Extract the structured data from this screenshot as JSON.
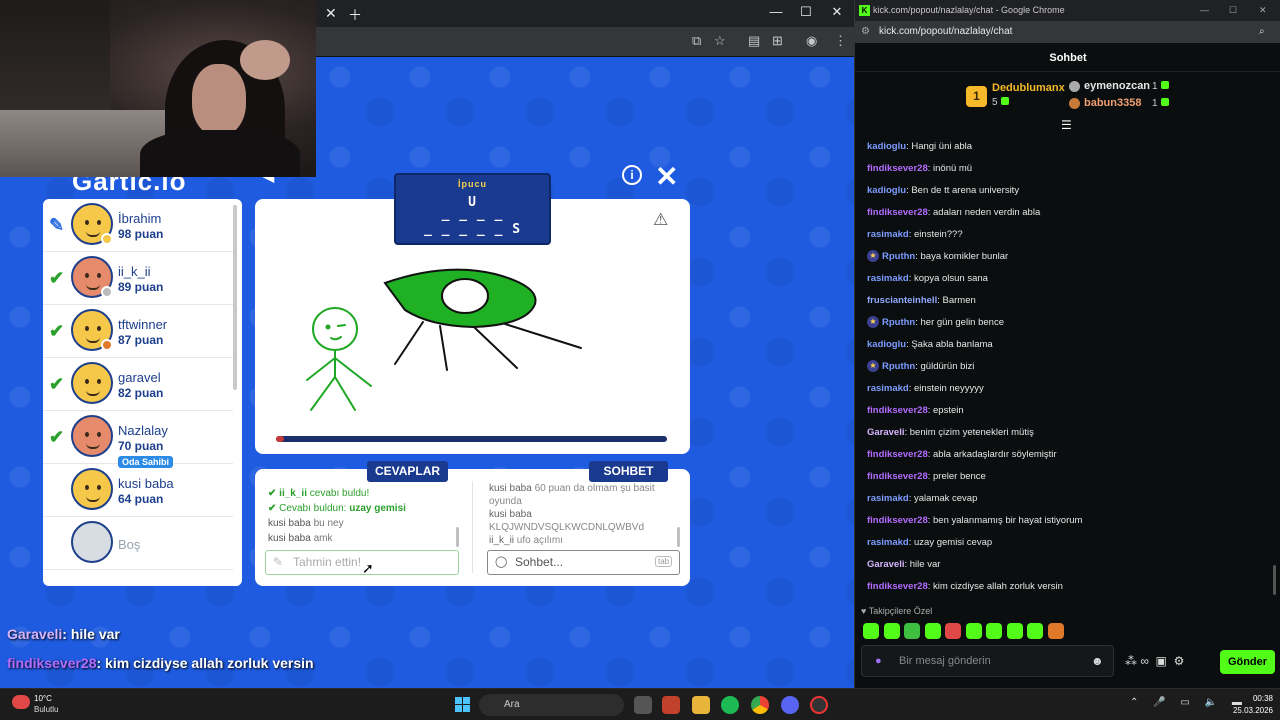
{
  "game_window": {
    "logo": "Gartic.io",
    "hint": {
      "title": "İpucu",
      "line1": "U",
      "line2": "_ _ _ _",
      "line3": "_ _ _ _ _ S"
    },
    "round_progress": 0.02,
    "players": [
      {
        "name": "İbrahim",
        "score": "98 puan",
        "mark": "pencil",
        "skin": "#f5c84a",
        "dot": "#f5c84a"
      },
      {
        "name": "ii_k_ii",
        "score": "89 puan",
        "mark": "check",
        "skin": "#e58a6a",
        "dot": "#bbbbbb"
      },
      {
        "name": "tftwinner",
        "score": "87 puan",
        "mark": "check",
        "skin": "#f5c84a",
        "dot": "#e07a2a"
      },
      {
        "name": "garavel",
        "score": "82 puan",
        "mark": "check",
        "skin": "#f5c84a",
        "dot": ""
      },
      {
        "name": "Nazlalay",
        "score": "70 puan",
        "mark": "check",
        "skin": "#e58a6a",
        "dot": "",
        "badge": "Oda Sahibi"
      },
      {
        "name": "kusi baba",
        "score": "64 puan",
        "mark": "",
        "skin": "#f5c84a",
        "dot": ""
      },
      {
        "name": "Boş",
        "score": "",
        "mark": "",
        "skin": "#d8dde3",
        "dot": ""
      }
    ],
    "tabs": {
      "answers": "CEVAPLAR",
      "chat": "SOHBET"
    },
    "answers": {
      "a1_user": "ii_k_ii",
      "a1_text": "cevabı buldu!",
      "a2_text": "Cevabı buldun:",
      "a2_word": "uzay gemisi",
      "a3_user": "kusi baba",
      "a3_text": "bu ney",
      "a4_user": "kusi baba",
      "a4_text": "amk"
    },
    "game_chat": {
      "c1_user": "kusi baba",
      "c1_text": "60 puan da olmam şu basit oyunda",
      "c2_user": "kusi baba",
      "c2_text": "KLQJWNDVSQLKWCDNLQWBVd",
      "c3_user": "ii_k_ii",
      "c3_text": "ufo açılımı"
    },
    "guess_placeholder": "Tahmin ettin!",
    "chat_placeholder": "Sohbet...",
    "tab_key": "tab",
    "overlay": [
      {
        "user": "Garaveli",
        "text": ": hile var",
        "color": "#d6b6ff"
      },
      {
        "user": "findiksever28",
        "text": ": kim cizdiyse allah zorluk versin",
        "color": "#b36cff"
      }
    ]
  },
  "kick_window": {
    "title": "kick.com/popout/nazlalay/chat - Google Chrome",
    "url": "kick.com/popout/nazlalay/chat",
    "header": "Sohbet",
    "leaderboard": {
      "first_name": "Dedublumanx",
      "first_count": "5",
      "first_rank": "1",
      "second_name": "eymenozcan",
      "second_count": "1",
      "third_name": "babun3358",
      "third_count": "1"
    },
    "messages": [
      {
        "user": "kadioglu",
        "text": ": Hangi üni abla",
        "color": "#7c9cff",
        "star": false
      },
      {
        "user": "findiksever28",
        "text": ": inönü mü",
        "color": "#b36cff",
        "star": false
      },
      {
        "user": "kadioglu",
        "text": ": Ben de tt arena university",
        "color": "#7c9cff",
        "star": false
      },
      {
        "user": "findiksever28",
        "text": ": adaları neden verdin abla",
        "color": "#b36cff",
        "star": false
      },
      {
        "user": "rasimakd",
        "text": ": einstein???",
        "color": "#7c9cff",
        "star": false
      },
      {
        "user": "Rputhn",
        "text": ": baya komikler bunlar",
        "color": "#7c9cff",
        "star": true
      },
      {
        "user": "rasimakd",
        "text": ": kopya olsun sana",
        "color": "#7c9cff",
        "star": false
      },
      {
        "user": "fruscianteinhell",
        "text": ": Barmen",
        "color": "#8fa8ff",
        "star": false
      },
      {
        "user": "Rputhn",
        "text": ": her gün gelin bence",
        "color": "#7c9cff",
        "star": true
      },
      {
        "user": "kadioglu",
        "text": ": Şaka abla banlama",
        "color": "#7c9cff",
        "star": false
      },
      {
        "user": "Rputhn",
        "text": ": güldürün bizi",
        "color": "#7c9cff",
        "star": true
      },
      {
        "user": "rasimakd",
        "text": ": einstein neyyyyy",
        "color": "#7c9cff",
        "star": false
      },
      {
        "user": "findiksever28",
        "text": ": epstein",
        "color": "#b36cff",
        "star": false
      },
      {
        "user": "Garaveli",
        "text": ": benim çizim yetenekleri mütiş",
        "color": "#d6b6ff",
        "star": false
      },
      {
        "user": "findiksever28",
        "text": ": abla arkadaşlardır söylemiştir",
        "color": "#b36cff",
        "star": false
      },
      {
        "user": "findiksever28",
        "text": ": preler bence",
        "color": "#b36cff",
        "star": false
      },
      {
        "user": "rasimakd",
        "text": ": yalamak cevap",
        "color": "#7c9cff",
        "star": false
      },
      {
        "user": "findiksever28",
        "text": ": ben yalanmamış bir hayat istiyorum",
        "color": "#b36cff",
        "star": false
      },
      {
        "user": "rasimakd",
        "text": ": uzay gemisi cevap",
        "color": "#7c9cff",
        "star": false
      },
      {
        "user": "Garaveli",
        "text": ": hile var",
        "color": "#d6b6ff",
        "star": false
      },
      {
        "user": "findiksever28",
        "text": ": kim cizdiyse allah zorluk versin",
        "color": "#b36cff",
        "star": false
      }
    ],
    "followers_label": "Takipçilere Özel",
    "input_placeholder": "Bir mesaj gönderin",
    "send_label": "Gönder"
  },
  "taskbar": {
    "weather_temp": "10°C",
    "weather_desc": "Bulutlu",
    "search_placeholder": "Ara",
    "time": "00:38",
    "date": "25.03.2026"
  }
}
